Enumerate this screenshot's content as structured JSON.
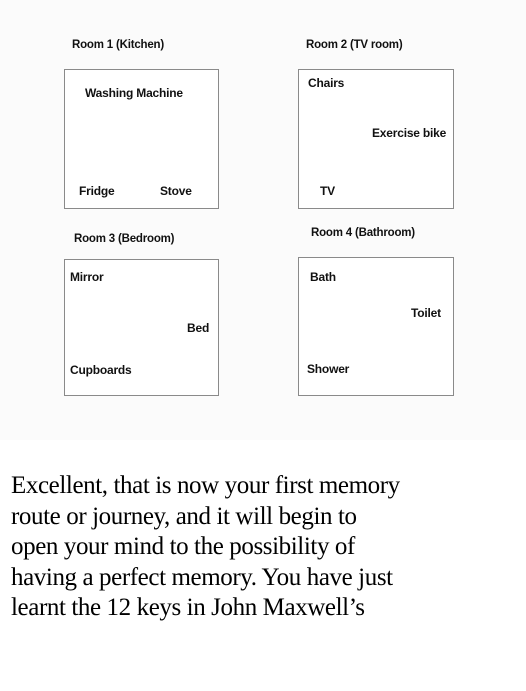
{
  "rooms": [
    {
      "title": "Room 1 (Kitchen)",
      "items": [
        "Washing Machine",
        "Fridge",
        "Stove"
      ]
    },
    {
      "title": "Room 2 (TV room)",
      "items": [
        "Chairs",
        "Exercise bike",
        "TV"
      ]
    },
    {
      "title": "Room 3 (Bedroom)",
      "items": [
        "Mirror",
        "Bed",
        "Cupboards"
      ]
    },
    {
      "title": "Room 4 (Bathroom)",
      "items": [
        "Bath",
        "Toilet",
        "Shower"
      ]
    }
  ],
  "body": {
    "lines": [
      "Excellent, that is now your first memory",
      "route or journey, and it will begin to",
      "open your mind to the possibility of",
      "having a perfect memory. You have just",
      "learnt the 12 keys in John Maxwell’s"
    ]
  }
}
